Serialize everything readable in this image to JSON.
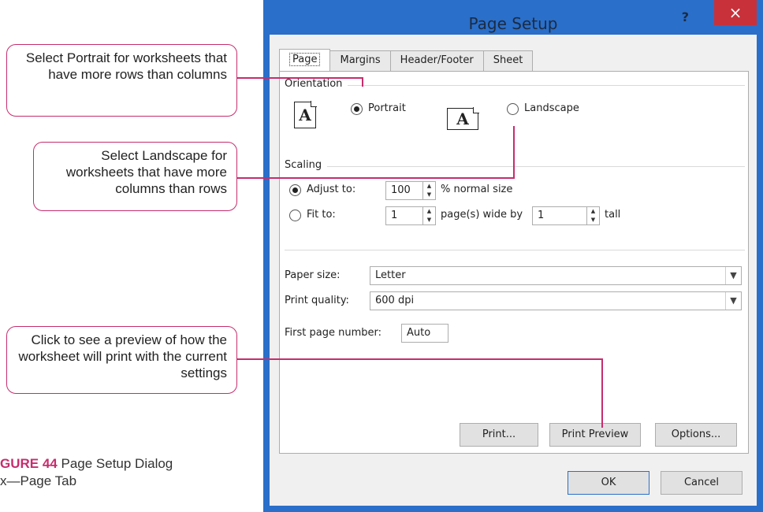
{
  "callouts": {
    "portrait": "Select Portrait for worksheets that have more rows than columns",
    "landscape": "Select Landscape for worksheets that have more columns than rows",
    "preview": "Click to see a preview of how the worksheet will print with the current settings"
  },
  "figure": {
    "label": "GURE 44",
    "caption": "Page Setup Dialog",
    "caption2": "x—Page Tab"
  },
  "dialog": {
    "title": "Page Setup",
    "help": "?",
    "close": "×",
    "tabs": [
      "Page",
      "Margins",
      "Header/Footer",
      "Sheet"
    ],
    "orientation": {
      "label": "Orientation",
      "portrait": "Portrait",
      "landscape": "Landscape",
      "icon_letter": "A",
      "selected": "portrait"
    },
    "scaling": {
      "label": "Scaling",
      "adjust_label": "Adjust to:",
      "adjust_value": "100",
      "adjust_suffix": "% normal size",
      "fit_label": "Fit to:",
      "fit_wide": "1",
      "fit_wide_suffix": "page(s) wide by",
      "fit_tall": "1",
      "fit_tall_suffix": "tall",
      "selected": "adjust"
    },
    "paper_size": {
      "label": "Paper size:",
      "value": "Letter"
    },
    "print_quality": {
      "label": "Print quality:",
      "value": "600 dpi"
    },
    "first_page": {
      "label": "First page number:",
      "value": "Auto"
    },
    "buttons": {
      "print": "Print...",
      "preview": "Print Preview",
      "options": "Options...",
      "ok": "OK",
      "cancel": "Cancel"
    }
  },
  "colors": {
    "accent": "#c62d6e",
    "frame": "#2a6fc9",
    "close": "#c8313a"
  }
}
